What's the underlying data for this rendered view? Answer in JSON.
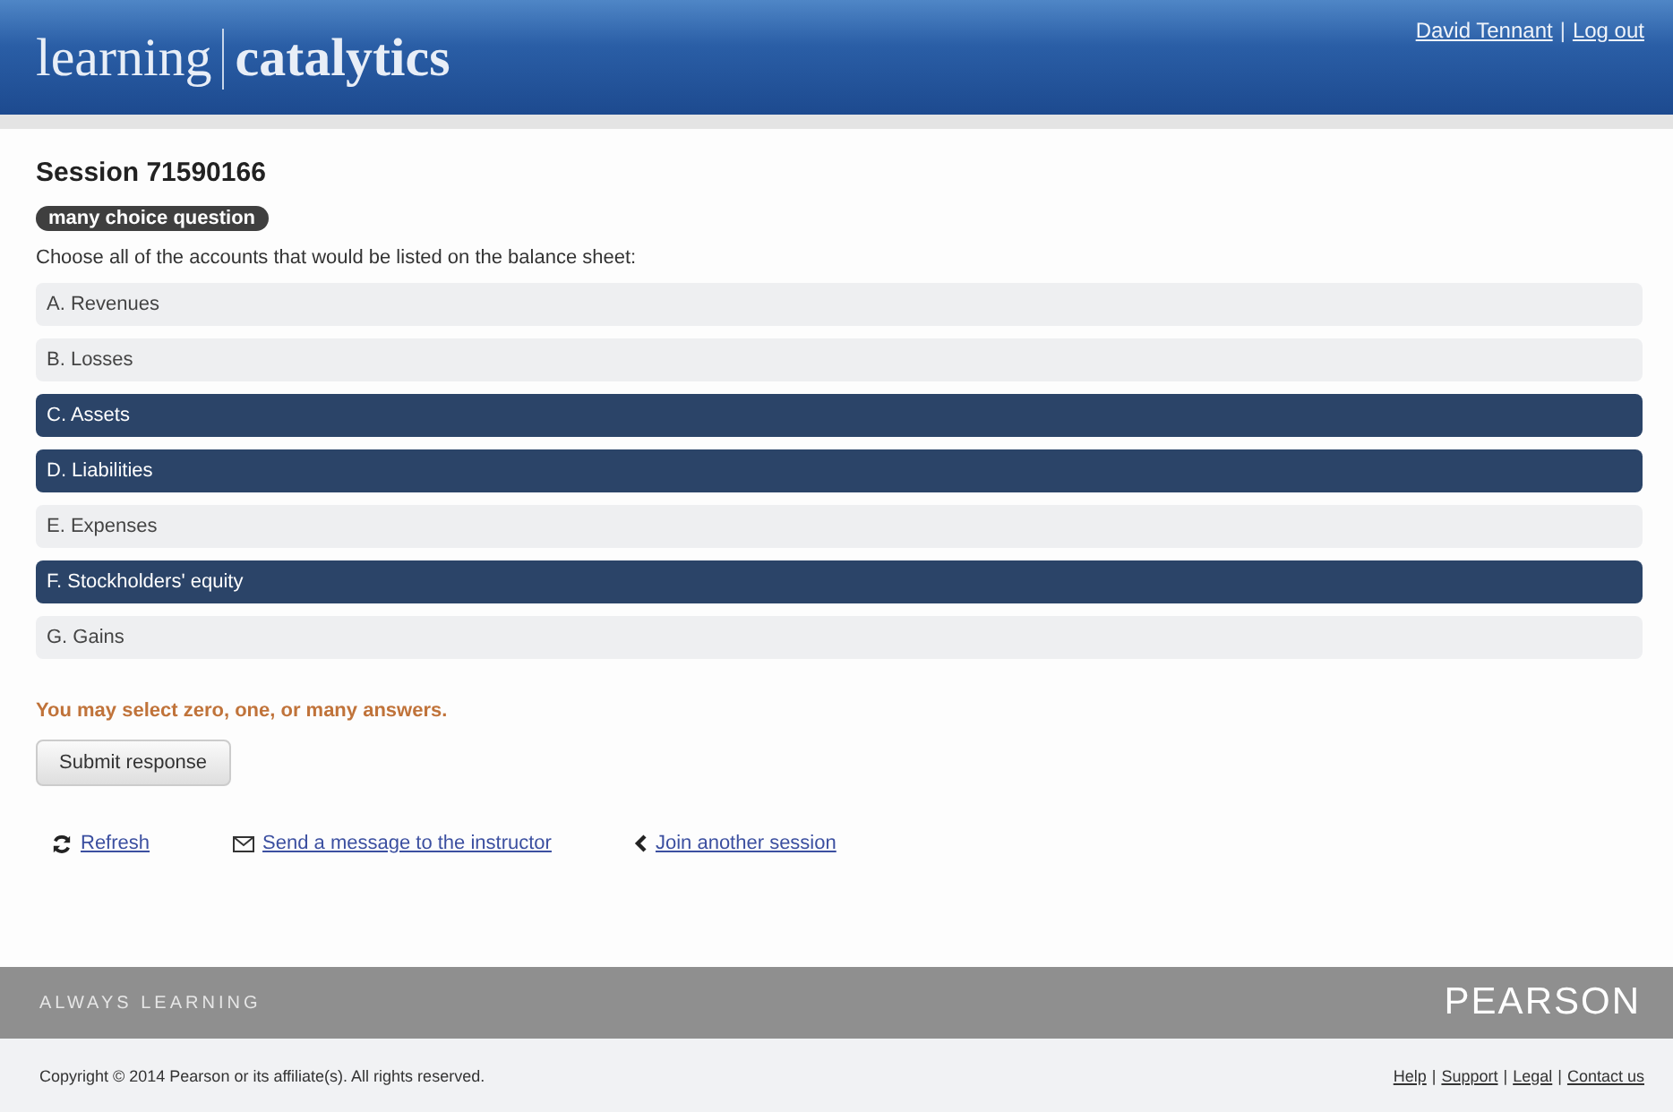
{
  "header": {
    "brand_light": "learning",
    "brand_bold": "catalytics",
    "user_links": [
      "David Tennant",
      "Log out"
    ],
    "separator": "|"
  },
  "session": {
    "title": "Session 71590166",
    "badge": "many choice question",
    "prompt": "Choose all of the accounts that would be listed on the balance sheet:",
    "options": [
      {
        "label": "A. Revenues",
        "selected": false
      },
      {
        "label": "B. Losses",
        "selected": false
      },
      {
        "label": "C. Assets",
        "selected": true
      },
      {
        "label": "D. Liabilities",
        "selected": true
      },
      {
        "label": "E. Expenses",
        "selected": false
      },
      {
        "label": "F. Stockholders' equity",
        "selected": true
      },
      {
        "label": "G. Gains",
        "selected": false
      }
    ],
    "hint": "You may select zero, one, or many answers.",
    "submit": "Submit response"
  },
  "actions": [
    {
      "kind": "refresh",
      "label": "Refresh"
    },
    {
      "kind": "mail",
      "label": "Send a message to the instructor"
    },
    {
      "kind": "back",
      "label": "Join another session"
    }
  ],
  "footer": {
    "tagline": "ALWAYS LEARNING",
    "logo": "PEARSON",
    "copyright": "Copyright © 2014 Pearson or its affiliate(s). All rights reserved.",
    "links": [
      "Help",
      "Support",
      "Legal",
      "Contact us"
    ],
    "separator": "|"
  }
}
